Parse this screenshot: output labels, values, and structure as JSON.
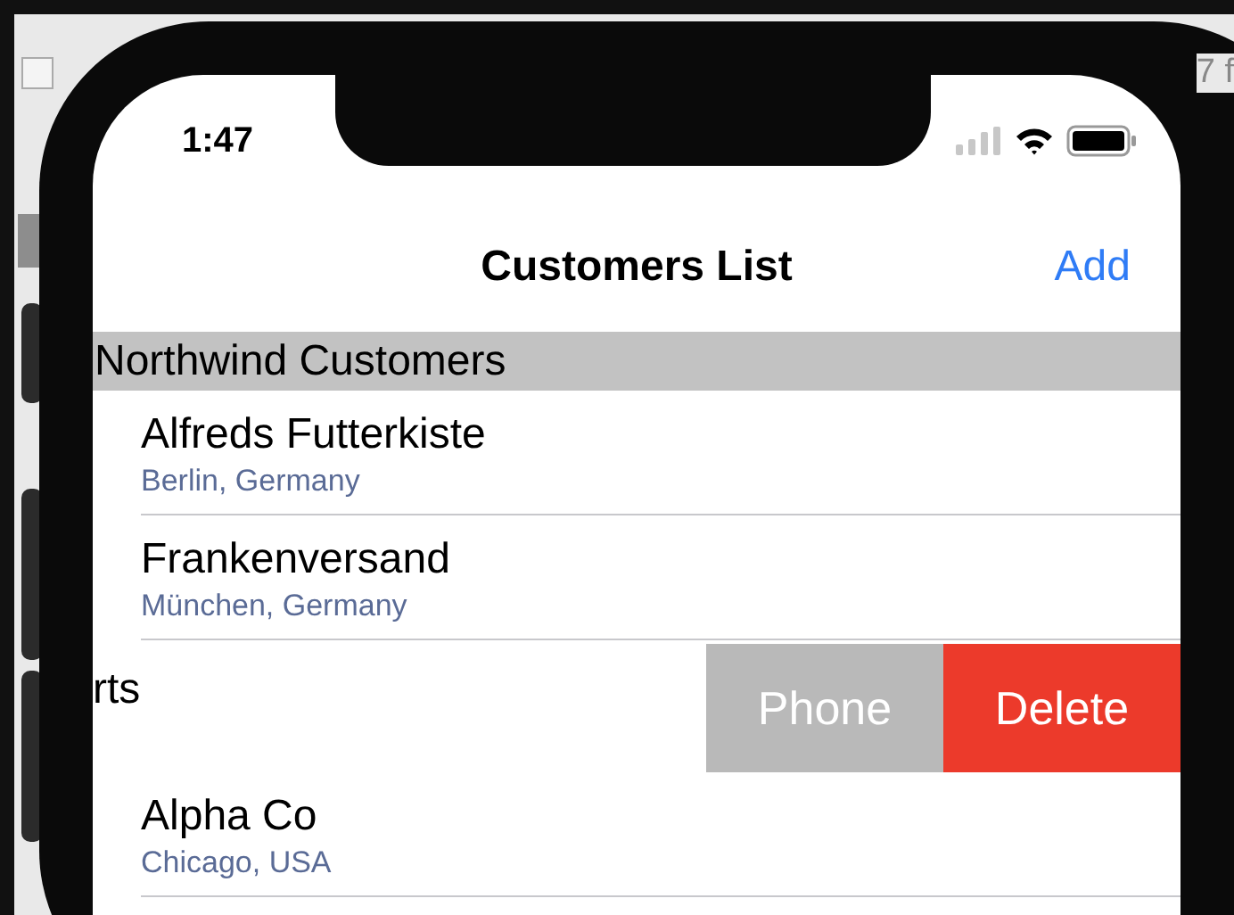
{
  "background": {
    "partial_text": "7 f",
    "checkbox_checked": false
  },
  "status_bar": {
    "time": "1:47"
  },
  "nav": {
    "title": "Customers List",
    "action": "Add"
  },
  "items": [
    {
      "kind": "header",
      "title": "Northwind Customers"
    },
    {
      "kind": "customer",
      "name": "Alfreds Futterkiste",
      "location": "Berlin, Germany"
    },
    {
      "kind": "customer",
      "name": "Frankenversand",
      "location": "München, Germany"
    },
    {
      "kind": "swiped",
      "text": "rts",
      "actions": [
        {
          "label": "Phone",
          "kind": "neutral"
        },
        {
          "label": "Delete",
          "kind": "destructive"
        }
      ]
    },
    {
      "kind": "customer",
      "name": "Alpha Co",
      "location": "Chicago, USA"
    }
  ]
}
